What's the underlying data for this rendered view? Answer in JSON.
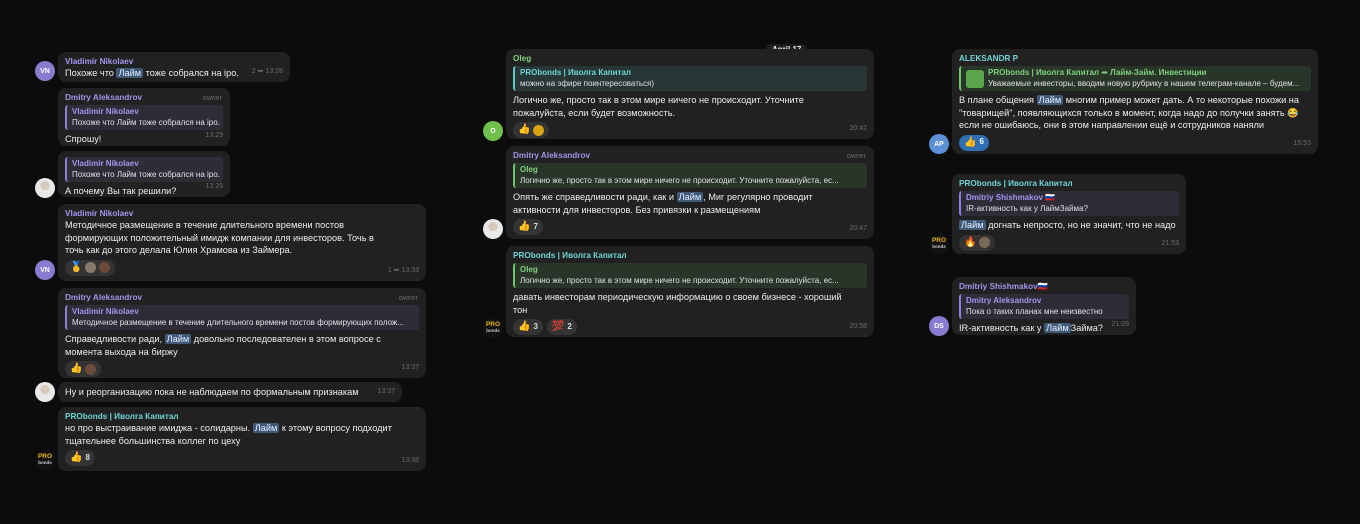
{
  "date_pill": "April 17",
  "colors": {
    "highlight": "#3f5a78",
    "purple": "#a294ea",
    "green": "#7ed17c",
    "teal": "#6ed3d5",
    "bubble": "#212121"
  },
  "left": {
    "m1": {
      "author": "Vladimir Nikolaev",
      "text_a": "Похоже что ",
      "hl": "Лайм",
      "text_b": " тоже собрался на ipo.",
      "time": "13:28",
      "forwards": "2",
      "avatar": "VN"
    },
    "m2": {
      "author": "Dmitry Aleksandrov",
      "role": "owner",
      "quote_author": "Vladimir Nikolaev",
      "quote_text": "Похоже что Лайм тоже собрался на ipo.",
      "text": "Спрошу!",
      "time": "13:29"
    },
    "m3": {
      "quote_author": "Vladimir Nikolaev",
      "quote_text": "Похоже что Лайм тоже собрался на ipo.",
      "text": "А почему Вы так решили?",
      "time": "13:29"
    },
    "m4": {
      "author": "Vladimir Nikolaev",
      "text": "Методичное размещение в течение длительного времени постов формирующих положительный имидж компании для инвесторов. Точь в точь как до этого делала Юлия Храмова из Займера.",
      "time": "13:33",
      "forwards": "1",
      "avatar": "VN",
      "react1": "🥇"
    },
    "m5": {
      "author": "Dmitry Aleksandrov",
      "role": "owner",
      "quote_author": "Vladimir Nikolaev",
      "quote_text": "Методичное размещение в течение длительного времени постов формирующих полож...",
      "text_a": "Справедливости ради, ",
      "hl": "Лайм",
      "text_b": " довольно последователен в этом вопросе с момента выхода на биржу",
      "time": "13:37",
      "react1": "👍"
    },
    "m6": {
      "text": "Ну и реорганизацию пока не наблюдаем по формальным признакам",
      "time": "13:37"
    },
    "m7": {
      "author": "PRObonds | Иволга Капитал",
      "text_a": "но про выстраивание имиджа - солидарны. ",
      "hl": "Лайм",
      "text_b": " к этому вопросу подходит тщательнее большинства коллег по цеху",
      "time": "13:38",
      "react1": "👍",
      "react1_count": "8",
      "avatar_top": "PRO",
      "avatar_bottom": "bonds"
    }
  },
  "middle": {
    "m1": {
      "author": "Oleg",
      "quote_author": "PRObonds | Иволга Капитал",
      "quote_text": "можно на эфире поинтересоваться)",
      "text": "Логично же, просто так в этом мире ничего не происходит. Уточните пожалуйста, если будет возможность.",
      "time": "20:42",
      "react1": "👍",
      "avatar": "O"
    },
    "m2": {
      "author": "Dmitry Aleksandrov",
      "role": "owner",
      "quote_author": "Oleg",
      "quote_text": "Логично же, просто так в этом мире ничего не происходит. Уточните пожалуйста, ес...",
      "text_a": "Опять же справедливости ради, как и ",
      "hl": "Лайм",
      "text_b": ", Миг регулярно проводит активности для инвесторов. Без привязки к размещениям",
      "time": "20:47",
      "react1": "👍",
      "react1_count": "7"
    },
    "m3": {
      "author": "PRObonds | Иволга Капитал",
      "quote_author": "Oleg",
      "quote_text": "Логично же, просто так в этом мире ничего не происходит. Уточните пожалуйста, ес...",
      "text": "давать инвесторам периодическую информацию о своем бизнесе - хороший тон",
      "time": "20:58",
      "react1": "👍",
      "react1_count": "3",
      "react2": "💯",
      "react2_count": "2",
      "avatar_top": "PRO",
      "avatar_bottom": "bonds"
    }
  },
  "right": {
    "m1": {
      "author": "ALEKSANDR P",
      "quote_author": "PRObonds | Иволга Капитал",
      "quote_arrow": "➦",
      "quote_channel": "Лайм-Займ. Инвестиции",
      "quote_text": "Уважаемые инвесторы, вводим новую рубрику в нашем телеграм-канале – будем...",
      "text_a": "В плане общения ",
      "hl": "Лайм",
      "text_b": " многим пример может дать. А то некоторые похожи на \"товарищей\", появляющихся только в момент, когда надо до получки занять 😂 если не ошибаюсь, они в этом направлении ещё и сотрудников наняли",
      "time": "15:53",
      "react1": "👍",
      "react1_count": "6",
      "avatar": "AP"
    },
    "m2": {
      "author": "PRObonds | Иволга Капитал",
      "quote_author": "Dmitriy Shishmakov 🇷🇺",
      "quote_text": "IR-активность как у ЛаймЗайма?",
      "hl": "Лайм",
      "text_b": " догнать непросто, но не значит, что не надо",
      "time": "21:53",
      "react1": "🔥",
      "avatar_top": "PRO",
      "avatar_bottom": "bonds"
    },
    "m3": {
      "author": "Dmitriy Shishmakov🇷🇺",
      "quote_author": "Dmitry Aleksandrov",
      "quote_text": "Пока о таких планах мне неизвестно",
      "text_a": "IR-активность как у ",
      "hl": "Лайм",
      "text_b": "Займа?",
      "time": "21:09",
      "avatar": "DS"
    }
  }
}
